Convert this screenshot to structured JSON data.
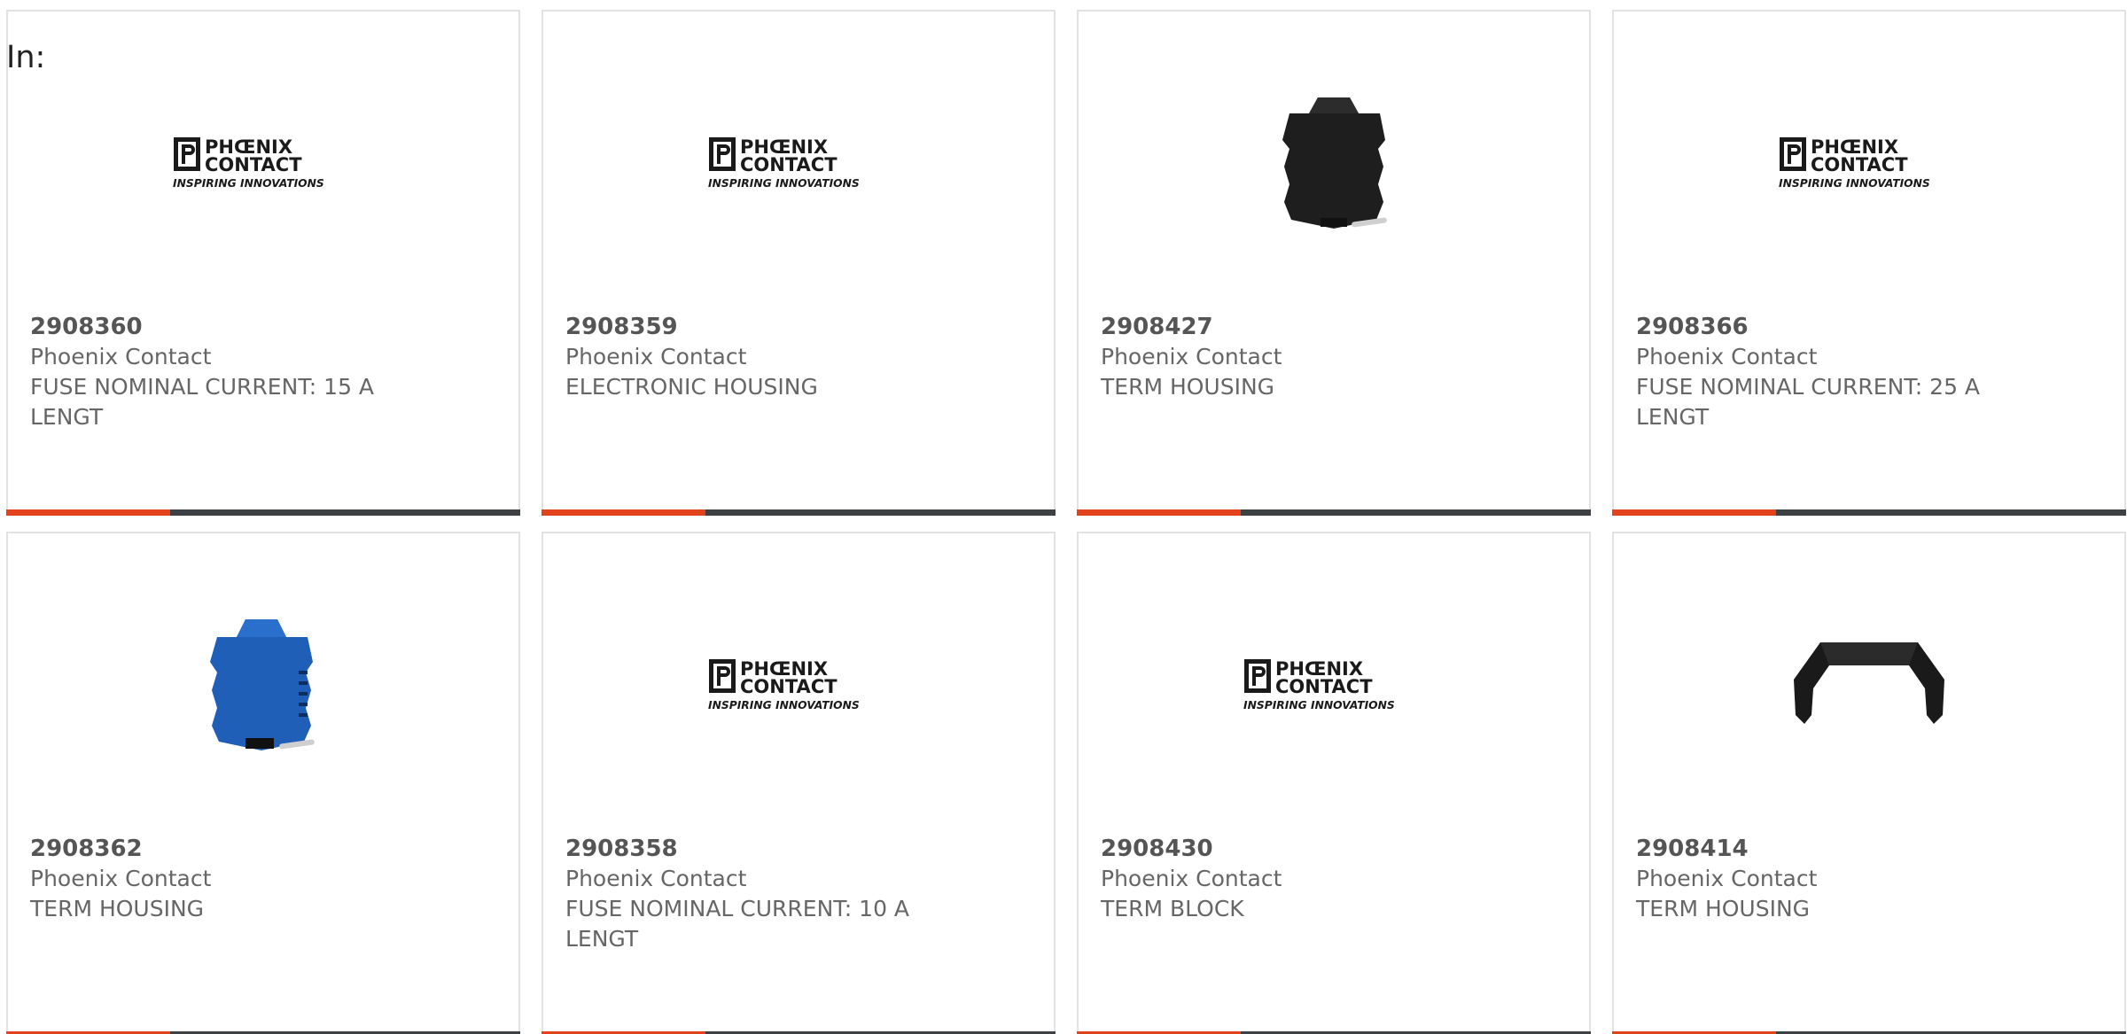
{
  "filter": {
    "label": "In:"
  },
  "colors": {
    "accent": "#e2431d",
    "bar": "#3e4144",
    "border": "#e2e2e2",
    "text": "#666666"
  },
  "products": [
    {
      "sku": "2908360",
      "brand": "Phoenix Contact",
      "description": "FUSE NOMINAL CURRENT: 15 A LENGT",
      "image": "phoenix-contact-logo"
    },
    {
      "sku": "2908359",
      "brand": "Phoenix Contact",
      "description": "ELECTRONIC HOUSING",
      "image": "phoenix-contact-logo"
    },
    {
      "sku": "2908427",
      "brand": "Phoenix Contact",
      "description": "TERM HOUSING",
      "image": "black-housing"
    },
    {
      "sku": "2908366",
      "brand": "Phoenix Contact",
      "description": "FUSE NOMINAL CURRENT: 25 A LENGT",
      "image": "phoenix-contact-logo"
    },
    {
      "sku": "2908362",
      "brand": "Phoenix Contact",
      "description": "TERM HOUSING",
      "image": "blue-housing"
    },
    {
      "sku": "2908358",
      "brand": "Phoenix Contact",
      "description": "FUSE NOMINAL CURRENT: 10 A LENGT",
      "image": "phoenix-contact-logo"
    },
    {
      "sku": "2908430",
      "brand": "Phoenix Contact",
      "description": "TERM BLOCK",
      "image": "phoenix-contact-logo"
    },
    {
      "sku": "2908414",
      "brand": "Phoenix Contact",
      "description": "TERM HOUSING",
      "image": "black-bridge-cover"
    }
  ],
  "logo": {
    "line1": "PHŒNIX",
    "line2": "CONTACT",
    "tagline": "INSPIRING INNOVATIONS"
  }
}
